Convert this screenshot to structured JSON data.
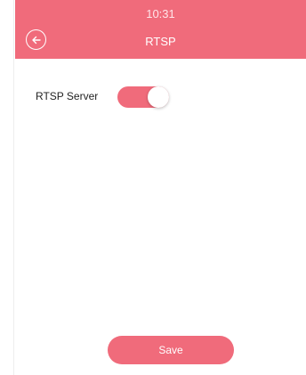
{
  "status_bar": {
    "time": "10:31"
  },
  "header": {
    "back_icon": "back-arrow-circle-icon",
    "title": "RTSP"
  },
  "settings": {
    "rtsp_server": {
      "label": "RTSP Server",
      "enabled": true
    }
  },
  "footer": {
    "save_label": "Save"
  },
  "colors": {
    "accent": "#f06b7b",
    "background": "#ffffff",
    "text": "#222222"
  }
}
